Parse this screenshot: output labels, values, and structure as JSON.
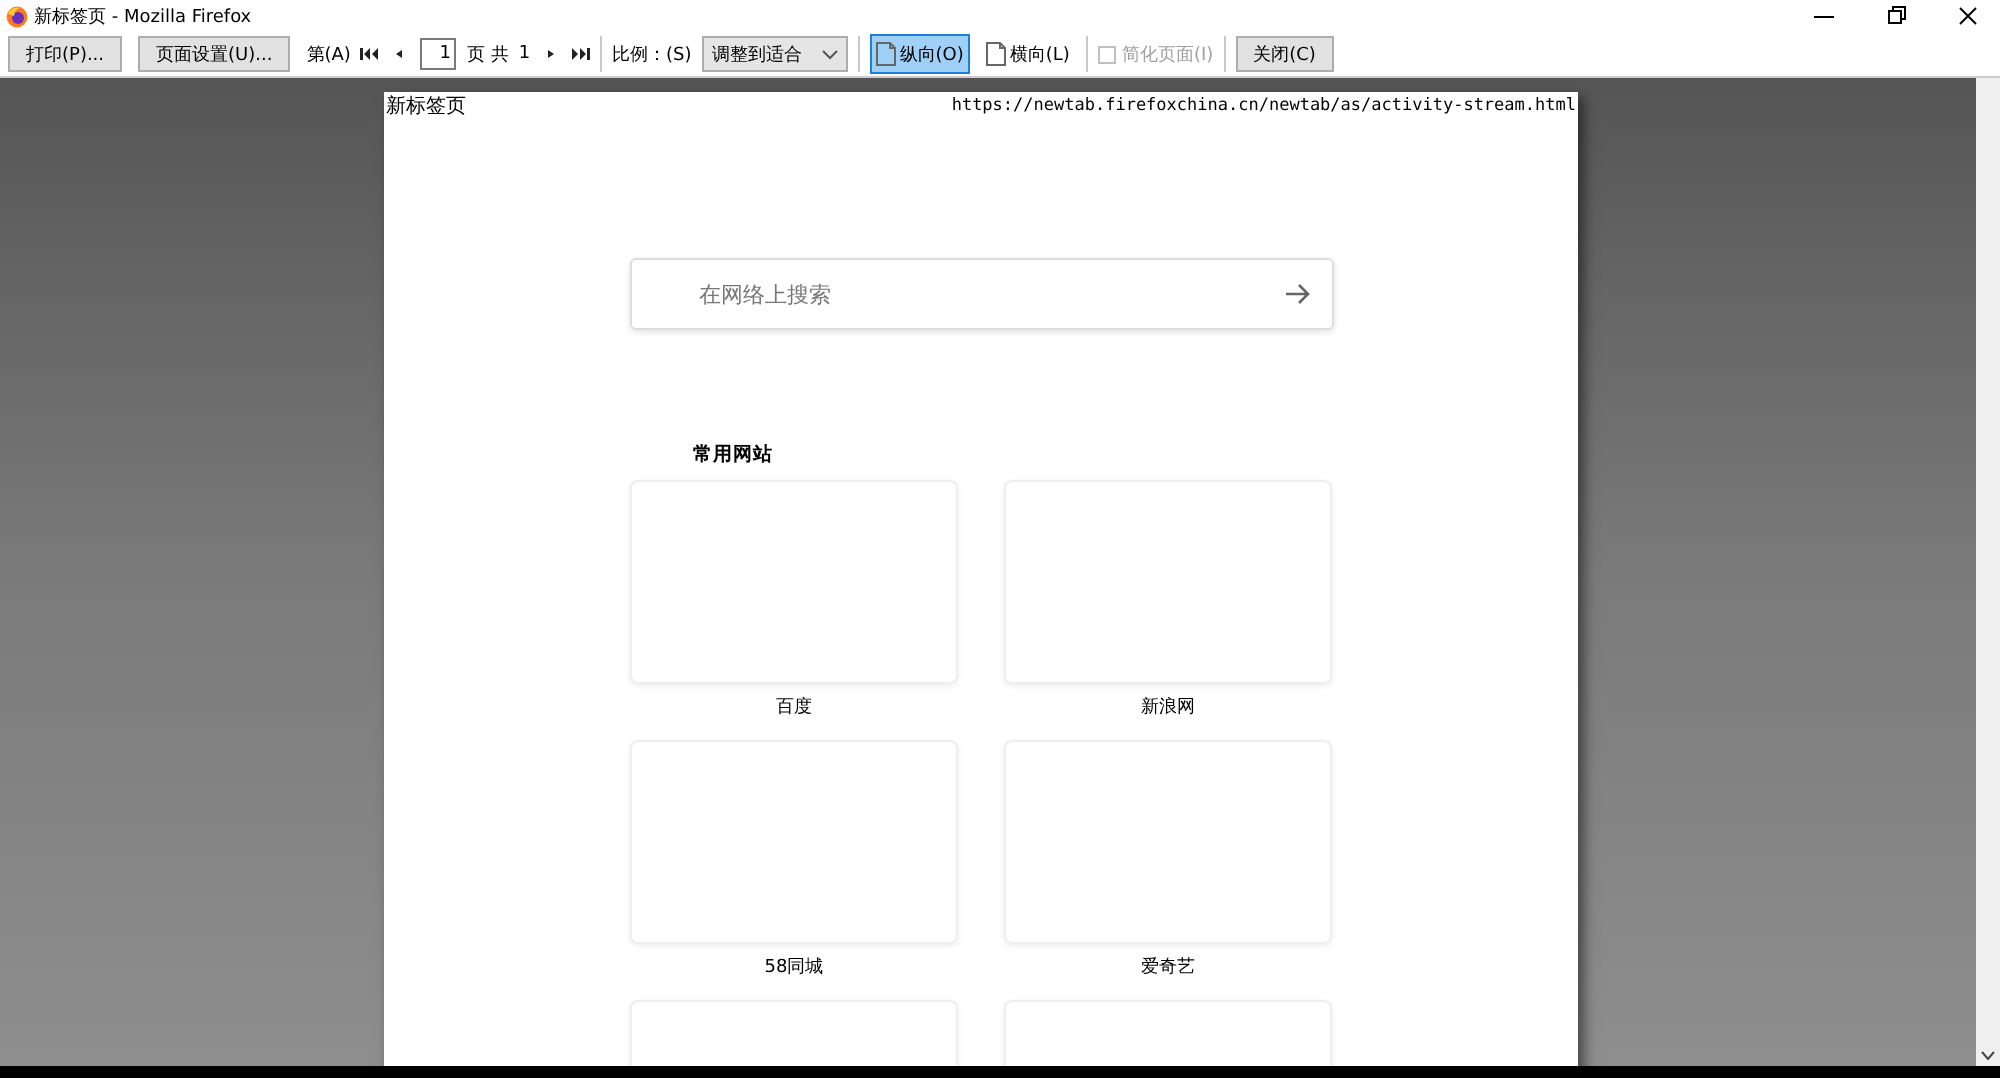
{
  "window": {
    "title": "新标签页 - Mozilla Firefox"
  },
  "toolbar": [
    {
      "kind": "button",
      "label": "打印(P)..."
    },
    {
      "kind": "button",
      "label": "页面设置(U)..."
    },
    {
      "kind": "label",
      "label": "第(A)"
    },
    {
      "kind": "nav"
    },
    {
      "kind": "nav"
    },
    {
      "kind": "input",
      "value": "1"
    },
    {
      "kind": "label",
      "label": "页 共"
    },
    {
      "kind": "label",
      "label": "1"
    },
    {
      "kind": "nav"
    },
    {
      "kind": "nav"
    },
    {
      "kind": "divider"
    },
    {
      "kind": "label",
      "label": "比例：(S)"
    },
    {
      "kind": "select",
      "value": "调整到适合"
    },
    {
      "kind": "divider"
    },
    {
      "kind": "toggle",
      "label": "纵向(O)",
      "selected": true
    },
    {
      "kind": "toggle",
      "label": "横向(L)",
      "selected": false
    },
    {
      "kind": "divider"
    },
    {
      "kind": "checkbox",
      "label": "简化页面(I)",
      "checked": false,
      "disabled": true
    },
    {
      "kind": "divider"
    },
    {
      "kind": "button",
      "label": "关闭(C)"
    }
  ],
  "page": {
    "header_left": "新标签页",
    "header_right": "https://newtab.firefoxchina.cn/newtab/as/activity-stream.html",
    "search": {
      "placeholder": "在网络上搜索"
    },
    "section_title": "常用网站",
    "tiles": [
      {
        "kind": "site",
        "label": "百度"
      },
      {
        "kind": "site",
        "label": "新浪网"
      },
      {
        "kind": "site",
        "label": "58同城"
      },
      {
        "kind": "site",
        "label": "爱奇艺"
      },
      {
        "kind": "partial"
      },
      {
        "kind": "partial"
      }
    ]
  }
}
